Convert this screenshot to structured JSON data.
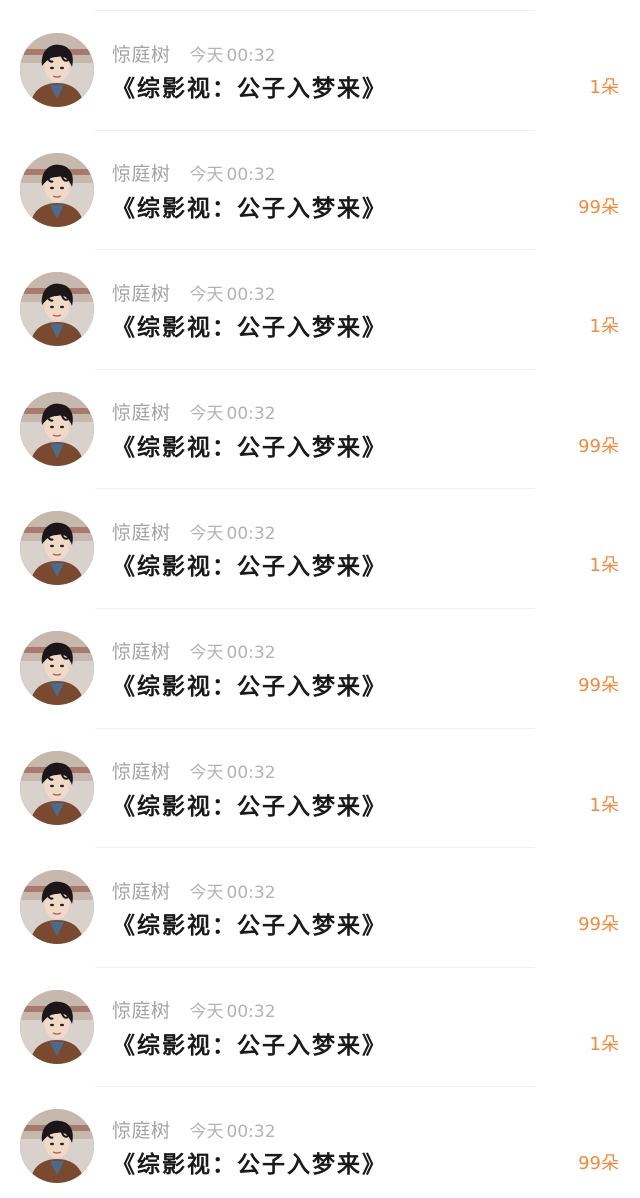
{
  "rows": [
    {
      "name": "惊庭树",
      "day": "今天",
      "time": "00:32",
      "title": "《综影视：公子入梦来》",
      "amount": "1",
      "unit": "朵"
    },
    {
      "name": "惊庭树",
      "day": "今天",
      "time": "00:32",
      "title": "《综影视：公子入梦来》",
      "amount": "99",
      "unit": "朵"
    },
    {
      "name": "惊庭树",
      "day": "今天",
      "time": "00:32",
      "title": "《综影视：公子入梦来》",
      "amount": "1",
      "unit": "朵"
    },
    {
      "name": "惊庭树",
      "day": "今天",
      "time": "00:32",
      "title": "《综影视：公子入梦来》",
      "amount": "99",
      "unit": "朵"
    },
    {
      "name": "惊庭树",
      "day": "今天",
      "time": "00:32",
      "title": "《综影视：公子入梦来》",
      "amount": "1",
      "unit": "朵"
    },
    {
      "name": "惊庭树",
      "day": "今天",
      "time": "00:32",
      "title": "《综影视：公子入梦来》",
      "amount": "99",
      "unit": "朵"
    },
    {
      "name": "惊庭树",
      "day": "今天",
      "time": "00:32",
      "title": "《综影视：公子入梦来》",
      "amount": "1",
      "unit": "朵"
    },
    {
      "name": "惊庭树",
      "day": "今天",
      "time": "00:32",
      "title": "《综影视：公子入梦来》",
      "amount": "99",
      "unit": "朵"
    },
    {
      "name": "惊庭树",
      "day": "今天",
      "time": "00:32",
      "title": "《综影视：公子入梦来》",
      "amount": "1",
      "unit": "朵"
    },
    {
      "name": "惊庭树",
      "day": "今天",
      "time": "00:32",
      "title": "《综影视：公子入梦来》",
      "amount": "99",
      "unit": "朵"
    }
  ],
  "colors": {
    "accent": "#f08a3c",
    "muted": "#a3a3a3",
    "title": "#1a1a1a"
  },
  "icons": {
    "avatar": "user-avatar-photo"
  }
}
